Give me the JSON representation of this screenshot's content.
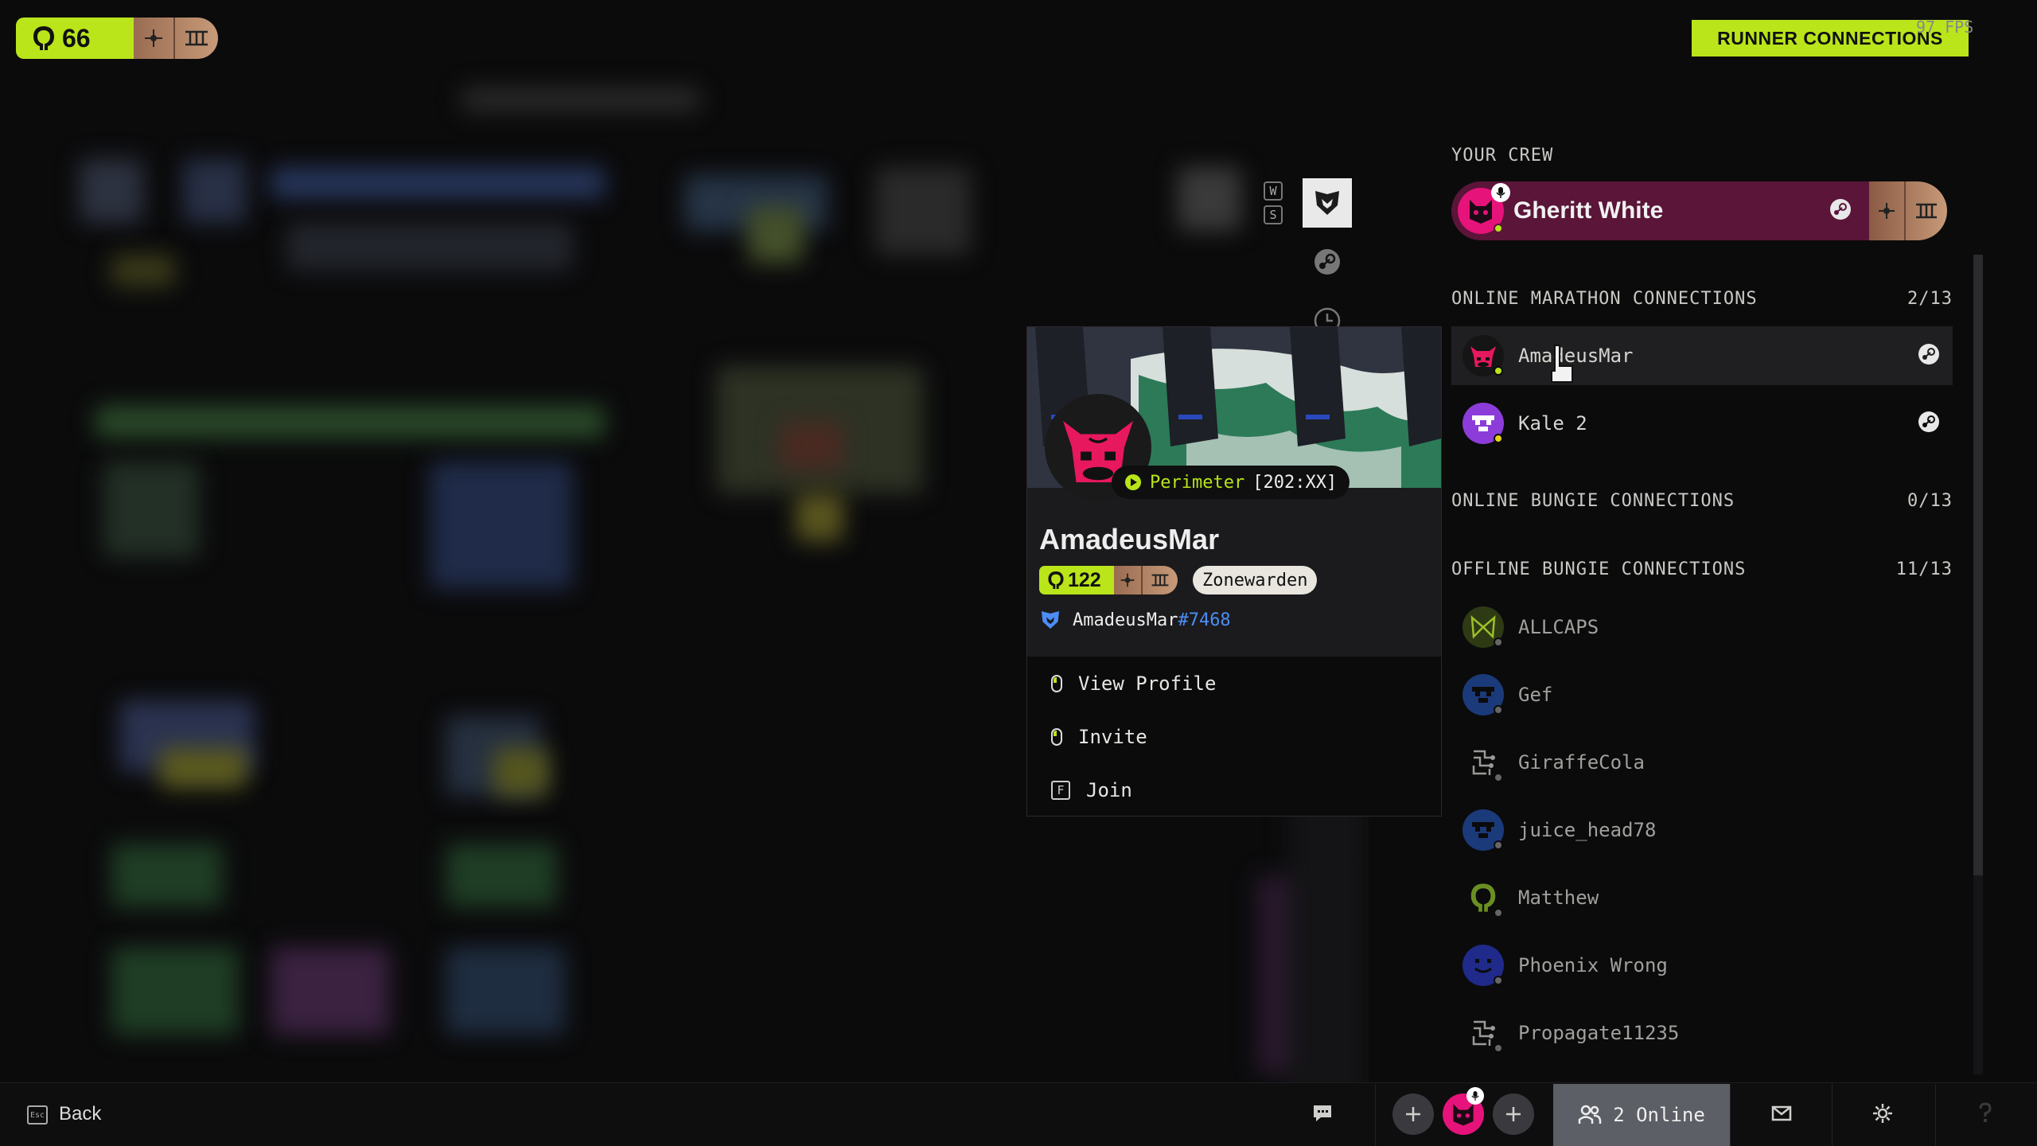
{
  "topbar": {
    "player_level": "66",
    "runner_connections_label": "RUNNER CONNECTIONS",
    "fps": "97 FPS"
  },
  "side_keys": [
    "W",
    "S"
  ],
  "crew": {
    "heading": "YOUR CREW",
    "member_name": "Gheritt White"
  },
  "sections": {
    "online_marathon": {
      "title": "ONLINE MARATHON CONNECTIONS",
      "count": "2/13"
    },
    "online_bungie": {
      "title": "ONLINE BUNGIE CONNECTIONS",
      "count": "0/13"
    },
    "offline_bungie": {
      "title": "OFFLINE BUNGIE CONNECTIONS",
      "count": "11/13"
    }
  },
  "online_friends": [
    {
      "name": "AmadeusMar"
    },
    {
      "name": "Kale 2"
    }
  ],
  "offline_friends": [
    {
      "name": "ALLCAPS"
    },
    {
      "name": "Gef"
    },
    {
      "name": "GiraffeCola"
    },
    {
      "name": "juice_head78"
    },
    {
      "name": "Matthew"
    },
    {
      "name": "Phoenix Wrong"
    },
    {
      "name": "Propagate11235"
    }
  ],
  "profile_popup": {
    "name": "AmadeusMar",
    "location": "Perimeter",
    "location_code": "[202:XX]",
    "level": "122",
    "title": "Zonewarden",
    "bungie_name": "AmadeusMar",
    "bungie_tag": "#7468",
    "menu": {
      "view_profile": "View Profile",
      "invite": "Invite",
      "join_key": "F",
      "join": "Join"
    }
  },
  "bottombar": {
    "esc_key": "Esc",
    "back_label": "Back",
    "online_count": "2 Online"
  },
  "colors": {
    "accent": "#b9e51a",
    "crew_card": "#5a1538",
    "bungie_tag": "#4c8df6"
  }
}
